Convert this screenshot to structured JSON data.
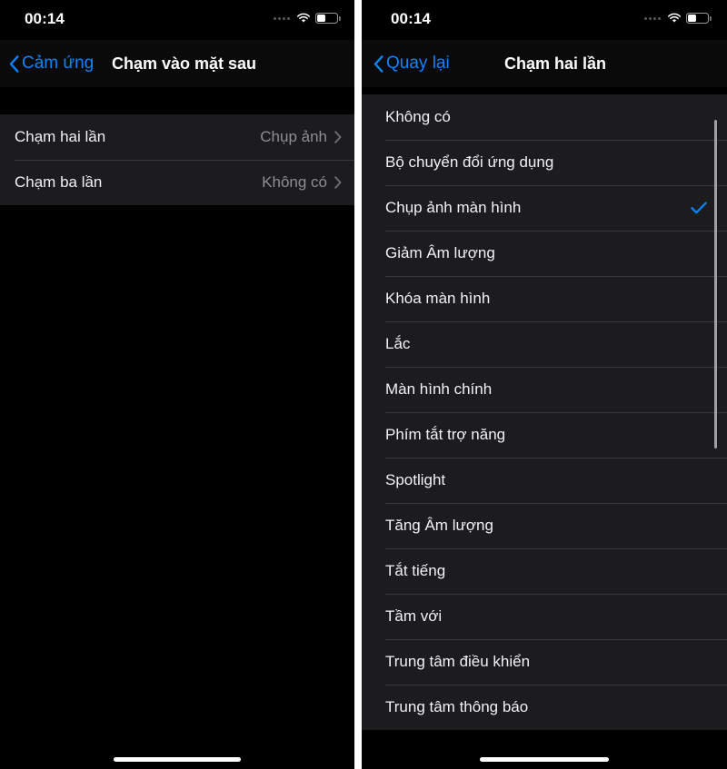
{
  "colors": {
    "accent": "#0a84ff",
    "row_bg": "#1c1c1e",
    "screen_bg": "#000000",
    "separator": "#38383a",
    "secondary_text": "#8e8e93",
    "primary_text": "#f2f2f4"
  },
  "left_phone": {
    "status": {
      "time": "00:14",
      "signal_icon": "signal-dots-icon",
      "wifi_icon": "wifi-icon",
      "battery_icon": "battery-icon"
    },
    "nav": {
      "back_icon": "chevron-left-icon",
      "back_label": "Cảm ứng",
      "title": "Chạm vào mặt sau"
    },
    "rows": [
      {
        "label": "Chạm hai lần",
        "value": "Chụp ảnh",
        "disclosure_icon": "chevron-right-icon"
      },
      {
        "label": "Chạm ba lần",
        "value": "Không có",
        "disclosure_icon": "chevron-right-icon"
      }
    ],
    "home_indicator": "home-indicator"
  },
  "right_phone": {
    "status": {
      "time": "00:14",
      "signal_icon": "signal-dots-icon",
      "wifi_icon": "wifi-icon",
      "battery_icon": "battery-icon"
    },
    "nav": {
      "back_icon": "chevron-left-icon",
      "back_label": "Quay lại",
      "title": "Chạm hai lần"
    },
    "options": [
      {
        "label": "Không có",
        "selected": false
      },
      {
        "label": "Bộ chuyển đổi ứng dụng",
        "selected": false
      },
      {
        "label": "Chụp ảnh màn hình",
        "selected": true
      },
      {
        "label": "Giảm Âm lượng",
        "selected": false
      },
      {
        "label": "Khóa màn hình",
        "selected": false
      },
      {
        "label": "Lắc",
        "selected": false
      },
      {
        "label": "Màn hình chính",
        "selected": false
      },
      {
        "label": "Phím tắt trợ năng",
        "selected": false
      },
      {
        "label": "Spotlight",
        "selected": false
      },
      {
        "label": "Tăng Âm lượng",
        "selected": false
      },
      {
        "label": "Tắt tiếng",
        "selected": false
      },
      {
        "label": "Tầm với",
        "selected": false
      },
      {
        "label": "Trung tâm điều khiển",
        "selected": false
      },
      {
        "label": "Trung tâm thông báo",
        "selected": false
      }
    ],
    "selected_icon": "checkmark-icon",
    "scrollbar": "vertical-scroll-indicator",
    "home_indicator": "home-indicator"
  }
}
